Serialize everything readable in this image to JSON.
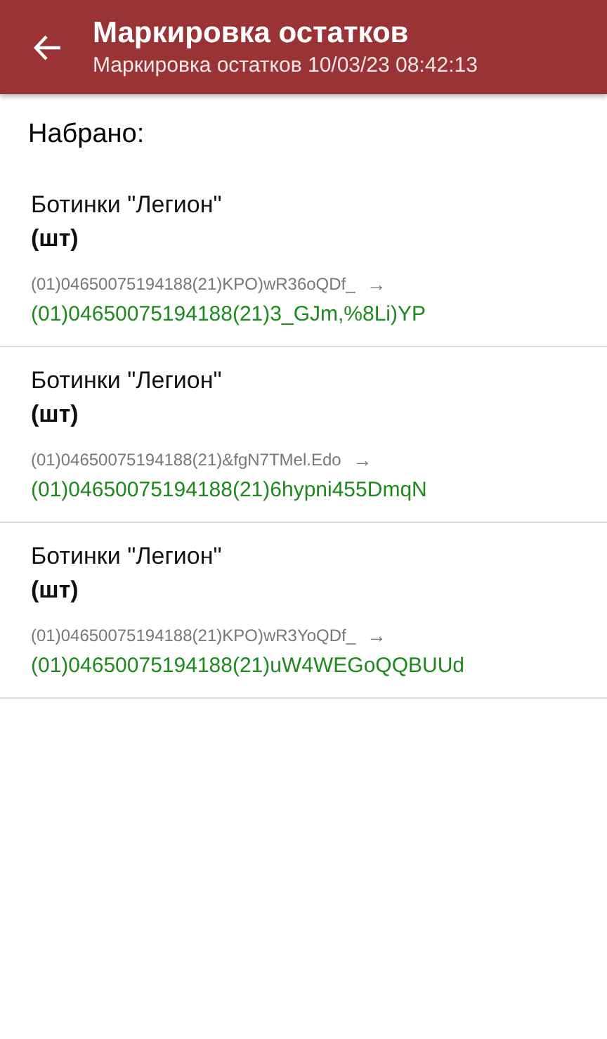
{
  "header": {
    "title": "Маркировка остатков",
    "subtitle": "Маркировка остатков 10/03/23 08:42:13"
  },
  "section_label": "Набрано:",
  "items": [
    {
      "name": "Ботинки \"Легион\"",
      "unit": "(шт)",
      "old_code": "(01)04650075194188(21)KPO)wR36oQDf_",
      "arrow": "→",
      "new_code": "(01)04650075194188(21)3_GJm,%8Li)YP"
    },
    {
      "name": "Ботинки \"Легион\"",
      "unit": "(шт)",
      "old_code": "(01)04650075194188(21)&fgN7TMel.Edo",
      "arrow": "→",
      "new_code": "(01)04650075194188(21)6hypni455DmqN"
    },
    {
      "name": "Ботинки \"Легион\"",
      "unit": "(шт)",
      "old_code": "(01)04650075194188(21)KPO)wR3YoQDf_",
      "arrow": "→",
      "new_code": "(01)04650075194188(21)uW4WEGoQQBUUd"
    }
  ]
}
